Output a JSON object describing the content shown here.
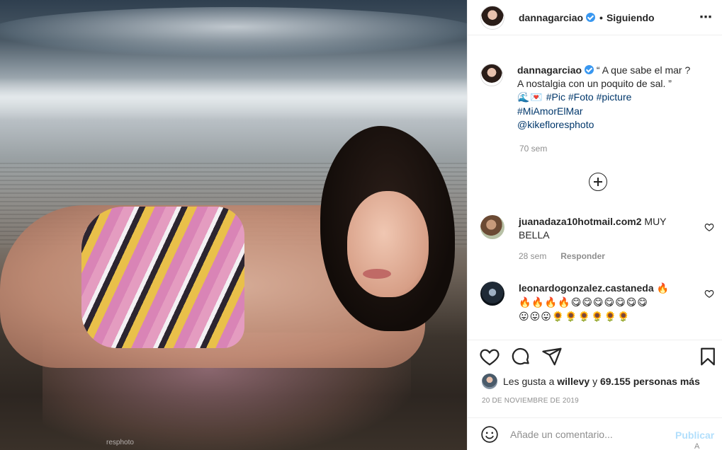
{
  "photo": {
    "watermark": "resphoto"
  },
  "header": {
    "username": "dannagarciao",
    "separator": "•",
    "follow_status": "Siguiendo",
    "more_icon": "ellipsis-icon"
  },
  "caption": {
    "username": "dannagarciao",
    "line1": "“ A que sabe el mar ?",
    "line2": "A nostalgia con un poquito de sal. ”",
    "emoji": "🌊💌",
    "tags_line3": [
      "#Pic",
      "#Foto",
      "#picture"
    ],
    "tag_line4": "#MiAmorElMar",
    "mention": "@kikefloresphoto",
    "time": "70 sem"
  },
  "comments": [
    {
      "username": "juanadaza10hotmail.com2",
      "text": "MUY BELLA",
      "time": "28 sem",
      "reply_label": "Responder"
    },
    {
      "username": "leonardogonzalez.castaneda",
      "text_line0": "🔥",
      "text_line1": "🔥🔥🔥🔥😋😋😋😋😋😋😋",
      "text_line2": "😛😛😛🌻🌻🌻🌻🌻🌻"
    }
  ],
  "actions": {
    "like_icon": "heart-icon",
    "comment_icon": "comment-icon",
    "share_icon": "share-icon",
    "save_icon": "bookmark-icon"
  },
  "likes": {
    "prefix": "Les gusta a",
    "user": "willevy",
    "connector": "y",
    "count": "69.155 personas más"
  },
  "date": "20 DE NOVIEMBRE DE 2019",
  "add_comment": {
    "placeholder": "Añade un comentario...",
    "publish_label": "Publicar",
    "overflow_text": "A"
  }
}
